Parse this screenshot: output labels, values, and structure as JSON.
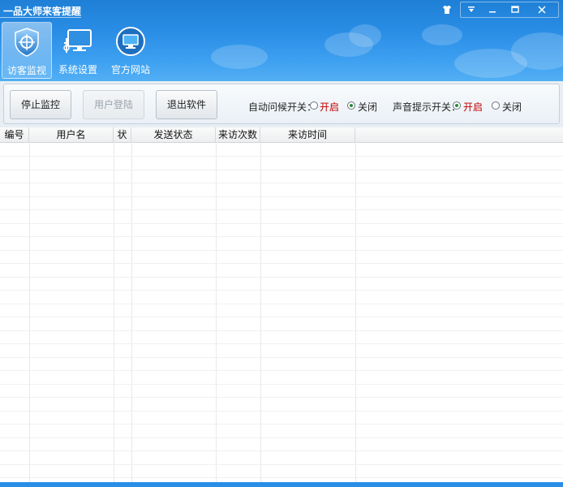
{
  "window": {
    "title": "一品大师来客提醒"
  },
  "nav": {
    "items": [
      {
        "label": "访客监视",
        "icon": "shield-icon",
        "active": true
      },
      {
        "label": "系统设置",
        "icon": "monitor-settings-icon",
        "active": false
      },
      {
        "label": "官方网站",
        "icon": "globe-monitor-icon",
        "active": false
      }
    ]
  },
  "toolbar": {
    "stop_label": "停止监控",
    "login_label": "用户登陆",
    "exit_label": "退出软件",
    "auto_greet": {
      "label": "自动问候开关：",
      "on": "开启",
      "off": "关闭",
      "selected": "off"
    },
    "sound_alert": {
      "label": "声音提示开关：",
      "on": "开启",
      "off": "关闭",
      "selected": "on"
    }
  },
  "table": {
    "columns": [
      "编号",
      "用户名",
      "状",
      "发送状态",
      "来访次数",
      "来访时间"
    ],
    "rows": []
  },
  "colors": {
    "header_blue": "#2a8ee6",
    "on_label_red": "#c00000"
  }
}
